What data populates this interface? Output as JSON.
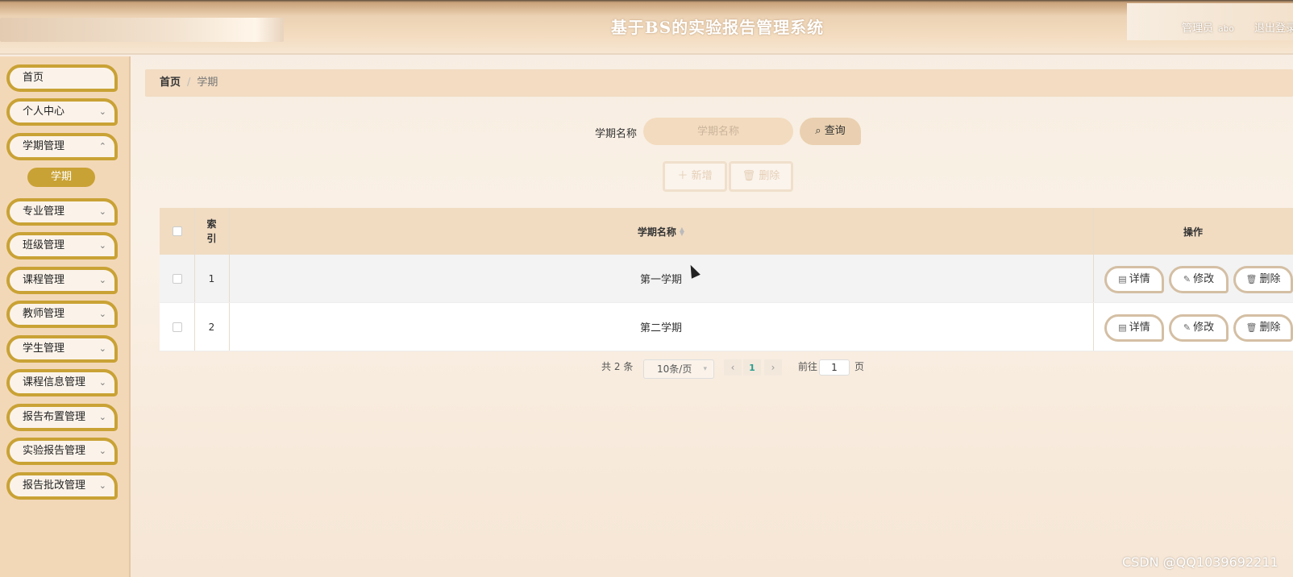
{
  "header": {
    "title": "基于BS的实验报告管理系统",
    "role": "管理员",
    "username": "abo",
    "logout": "退出登录"
  },
  "sidebar": {
    "items": [
      {
        "label": "首页",
        "has_chevron": false
      },
      {
        "label": "个人中心",
        "has_chevron": true
      },
      {
        "label": "学期管理",
        "has_chevron": true
      },
      {
        "label": "专业管理",
        "has_chevron": true
      },
      {
        "label": "班级管理",
        "has_chevron": true
      },
      {
        "label": "课程管理",
        "has_chevron": true
      },
      {
        "label": "教师管理",
        "has_chevron": true
      },
      {
        "label": "学生管理",
        "has_chevron": true
      },
      {
        "label": "课程信息管理",
        "has_chevron": true
      },
      {
        "label": "报告布置管理",
        "has_chevron": true
      },
      {
        "label": "实验报告管理",
        "has_chevron": true
      },
      {
        "label": "报告批改管理",
        "has_chevron": true
      }
    ],
    "active_sub": "学期"
  },
  "breadcrumb": {
    "home": "首页",
    "separator": "/",
    "current": "学期"
  },
  "search": {
    "label": "学期名称",
    "placeholder": "学期名称",
    "button": "查询"
  },
  "actions": {
    "add": "新增",
    "delete": "删除"
  },
  "table": {
    "headers": {
      "index": "索\n引",
      "name": "学期名称",
      "ops": "操作"
    },
    "rows": [
      {
        "index": "1",
        "name": "第一学期"
      },
      {
        "index": "2",
        "name": "第二学期"
      }
    ],
    "row_buttons": {
      "detail": "详情",
      "edit": "修改",
      "delete": "删除"
    }
  },
  "pagination": {
    "total_prefix": "共",
    "total": "2",
    "total_suffix": "条",
    "page_size": "10条/页",
    "current_page": "1",
    "goto_prefix": "前往",
    "goto_value": "1",
    "goto_suffix": "页"
  },
  "watermark": "CSDN @QQ1039692211",
  "colors": {
    "accent": "#c9a235",
    "header_bg": "#f1dcc2",
    "sidebar_bg": "#f3d8b8"
  }
}
